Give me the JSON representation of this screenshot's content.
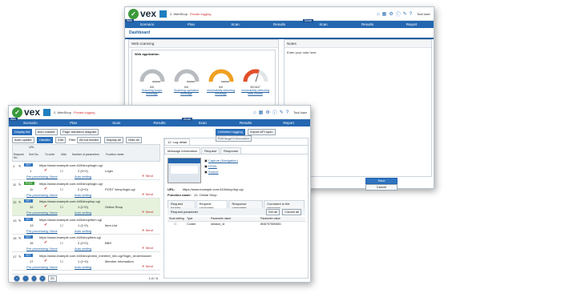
{
  "back_window": {
    "title": "2. WebShop",
    "lock_text": "Private logging",
    "user": "Tool User",
    "nav": [
      "Scenario",
      "Plan",
      "Scan",
      "Results",
      "Scan",
      "Results",
      "Report"
    ],
    "nav_tags": [
      "Web",
      "Server"
    ],
    "section": "Dashboard",
    "panel_title": "Web scanning",
    "subpanel_title": "Web application",
    "gauges": [
      {
        "value": "6/6",
        "label": "Scanning scope message",
        "color": "#b8bcc0",
        "level": 1.0
      },
      {
        "value": "6/6",
        "label": "Scanning operation message",
        "color": "#b8bcc0",
        "level": 1.0
      },
      {
        "value": "6/6",
        "label": "Vulnerability detecting message",
        "color": "#f0a020",
        "level": 1.0
      },
      {
        "value": "30/1647",
        "label": "Vulnerability detecting total counts",
        "color": "#e0502a",
        "level": 0.6
      }
    ],
    "notes_title": "Notes",
    "notes_placeholder": "Enter your note here.",
    "save": "Save",
    "cancel": "Cancel"
  },
  "front_window": {
    "title": "2. WebShop",
    "lock_text": "Private logging",
    "user": "Tool User",
    "nav": [
      "Scenario",
      "Plan",
      "Scan",
      "Results",
      "Scan",
      "Results",
      "Report"
    ],
    "nav_tags": [
      "Web",
      "Server"
    ],
    "toolbar": [
      "Display list",
      "Auto crawler",
      "Page transition diagram"
    ],
    "toolbar_right": [
      "Unlimited logging",
      "Import API spec.",
      "Edit target information"
    ],
    "filter_row": [
      "Auto update",
      "Handler",
      "Edit",
      "Filter",
      "All but hidden",
      "Display all",
      "Hide all"
    ],
    "col_headers": [
      "Request No.",
      "Sort No.",
      "To order",
      "Hide",
      "Number of parameters",
      "Function name"
    ],
    "url_header": "URL",
    "rows": [
      {
        "no": "1",
        "sort": "1",
        "url": "https://www.example.com:443/shop/login.cgi",
        "params": "2 (0+2)",
        "func": "Login",
        "badge": "GET",
        "pre": "Pre-processing: None",
        "auto": "Auto setting",
        "send": "Send"
      },
      {
        "no": "11",
        "sort": "11",
        "url": "https://www.example.com:443/shop/login.cgi",
        "params": "2 (2+0)",
        "func": "POST /shop/login.cgi",
        "badge": "POST",
        "pre": "Pre-processing: None",
        "auto": "Auto setting",
        "send": "Send"
      },
      {
        "no": "12",
        "sort": "12",
        "url": "https://www.example.com:443/shop/top.cgi",
        "params": "1 (1+0)",
        "func": "Online Shop",
        "badge": "GET",
        "pre": "Pre-processing: None",
        "auto": "Auto setting",
        "send": "Send"
      },
      {
        "no": "13",
        "sort": "13",
        "url": "https://www.example.com:443/shop/item.cgi",
        "params": "1 (1+0)",
        "func": "Item List",
        "badge": "GET",
        "pre": "Pre-processing: None",
        "auto": "Auto setting",
        "send": "Send"
      },
      {
        "no": "15",
        "sort": "15",
        "url": "https://www.example.com:443/shop/bbs.cgi",
        "params": "2 (2+0)",
        "func": "BBS",
        "badge": "GET",
        "pre": "Pre-processing: None",
        "auto": "Auto setting",
        "send": "Send"
      },
      {
        "no": "17",
        "sort": "17",
        "url": "https://www.example.com:443/shop/view_member_info.cgi?login_id=demouser",
        "params": "1 (1+0)",
        "func": "Member Information",
        "badge": "GET",
        "pre": "Pre-processing: None",
        "auto": "Auto setting",
        "send": "Send"
      }
    ],
    "pager": "1-6 / 6",
    "page_size": "20",
    "log_tab": "12: Log detail",
    "detail_tabs": [
      "Message information",
      "Request",
      "Response"
    ],
    "links": [
      "Capture (Navigation)",
      "HTML",
      "Source"
    ],
    "url_label": "URL:",
    "url_value": "https://www.example.com:443/shop/top.cgi",
    "func_label": "Function name:",
    "func_value": "12: Online Shop",
    "param_tabs": [
      "Request header",
      "Request parameter",
      "Response parameter",
      "Comment in the response"
    ],
    "param_sub": "Request parameter",
    "set_all": "Set all",
    "cancel_all": "Cancel all",
    "param_headers": [
      "Scan setting",
      "Type",
      "Parameter name",
      "Parameter value"
    ],
    "param_row": {
      "type": "Cookie",
      "name": "session_id",
      "value": "8f4675755f3651"
    }
  }
}
